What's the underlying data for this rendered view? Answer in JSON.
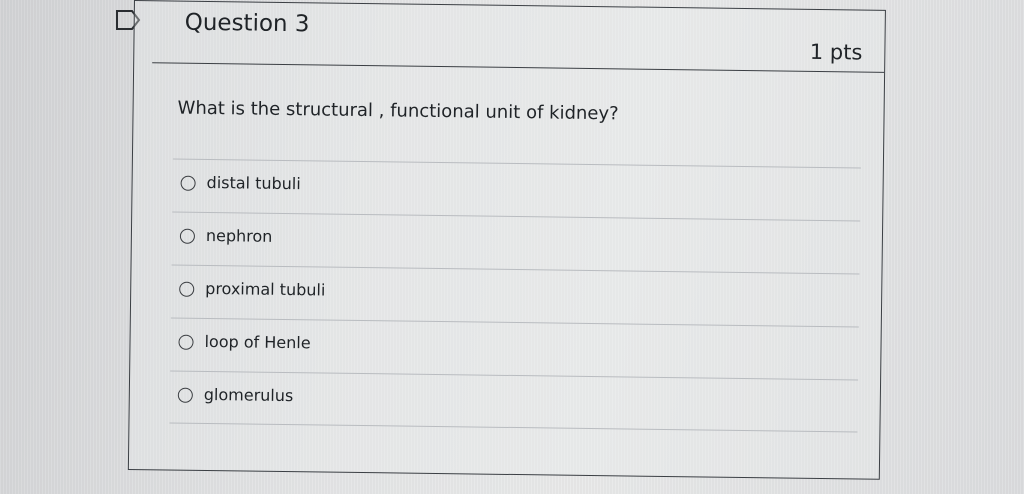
{
  "question": {
    "title": "Question 3",
    "points": "1 pts",
    "text": "What is the structural , functional unit of kidney?",
    "flag_icon": "flag-icon",
    "answers": [
      {
        "label": "distal tubuli"
      },
      {
        "label": "nephron"
      },
      {
        "label": "proximal tubuli"
      },
      {
        "label": "loop of Henle"
      },
      {
        "label": "glomerulus"
      }
    ]
  }
}
